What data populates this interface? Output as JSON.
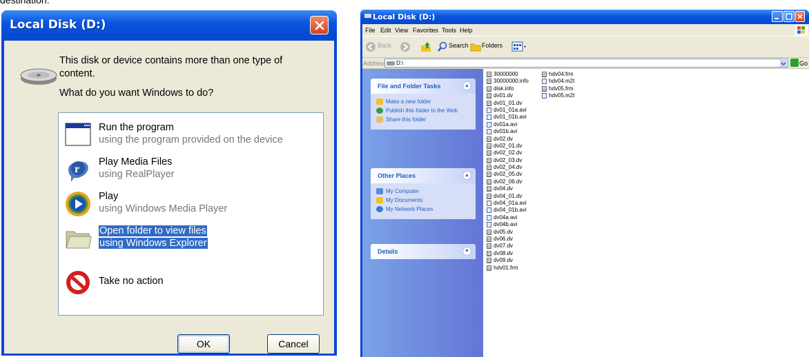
{
  "caption": "destination.",
  "dialog": {
    "title": "Local Disk (D:)",
    "message": "This disk or device contains more than one type of content.",
    "question": "What do you want Windows to do?",
    "options": [
      {
        "title": "Run the program",
        "subtitle": "using the program provided on the device",
        "icon": "program-window-icon",
        "selected": false
      },
      {
        "title": "Play Media Files",
        "subtitle": "using RealPlayer",
        "icon": "realplayer-icon",
        "selected": false
      },
      {
        "title": "Play",
        "subtitle": "using Windows Media Player",
        "icon": "windows-media-player-icon",
        "selected": false
      },
      {
        "title": "Open folder to view files",
        "subtitle": "using Windows Explorer",
        "icon": "folder-icon",
        "selected": true
      },
      {
        "title": "Take no action",
        "subtitle": "",
        "icon": "no-action-icon",
        "selected": false
      }
    ],
    "ok_label": "OK",
    "cancel_label": "Cancel"
  },
  "explorer": {
    "title": "Local Disk (D:)",
    "menu": [
      "File",
      "Edit",
      "View",
      "Favorites",
      "Tools",
      "Help"
    ],
    "toolbar": {
      "back": "Back",
      "search": "Search",
      "folders": "Folders"
    },
    "address_label": "Address",
    "address_value": "D:\\",
    "go_label": "Go",
    "panels": {
      "file_tasks": {
        "title": "File and Folder Tasks",
        "items": [
          "Make a new folder",
          "Publish this folder to the Web",
          "Share this folder"
        ]
      },
      "other_places": {
        "title": "Other Places",
        "items": [
          "My Computer",
          "My Documents",
          "My Network Places"
        ]
      },
      "details": {
        "title": "Details"
      }
    },
    "files_col1": [
      "30000000",
      "30000000.info",
      "disk.info",
      "dv01.dv",
      "dv01_01.dv",
      "dv01_01a.avi",
      "dv01_01b.avi",
      "dv01a.avi",
      "dv01b.avi",
      "dv02.dv",
      "dv02_01.dv",
      "dv02_02.dv",
      "dv02_03.dv",
      "dv02_04.dv",
      "dv02_05.dv",
      "dv02_06.dv",
      "dv04.dv",
      "dv04_01.dv",
      "dv04_01a.avi",
      "dv04_01b.avi",
      "dv04a.avi",
      "dv04b.avi",
      "dv05.dv",
      "dv06.dv",
      "dv07.dv",
      "dv08.dv",
      "dv09.dv",
      "hdv01.frm"
    ],
    "files_col2": [
      "hdv04.frm",
      "hdv04.m2t",
      "hdv05.frm",
      "hdv05.m2t"
    ]
  },
  "colors": {
    "xp_blue": "#0a47d6",
    "selection": "#316ac5",
    "task_link": "#215dc6"
  }
}
